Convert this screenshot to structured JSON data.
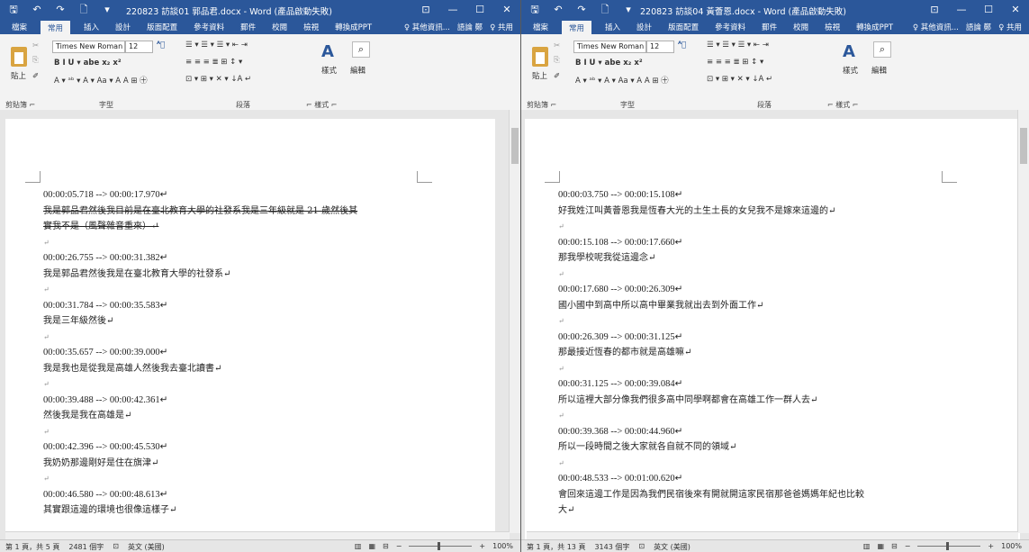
{
  "windows": [
    {
      "title": "220823 訪談01 郭品君.docx - Word (產品啟動失敗)",
      "qat": {
        "save": "🖫",
        "undo": "↶",
        "redo": "↷",
        "new": "🗋",
        "more": "▾"
      },
      "controls": {
        "ribbon_display": "⊡",
        "minimize": "—",
        "restore": "☐",
        "close": "✕"
      },
      "tabs": [
        "檔案",
        "常用",
        "插入",
        "設計",
        "版面配置",
        "參考資料",
        "郵件",
        "校閱",
        "檢視",
        "轉換成PPT"
      ],
      "tell_me": "♀ 其他資訊...",
      "user": "語論 鄭",
      "share": "♀ 共用",
      "ribbon": {
        "font_name": "Times New Roman",
        "font_size": "12",
        "paste": "貼上",
        "styles": "樣式",
        "edit": "編輯",
        "groups": [
          "剪貼簿 ⌐",
          "字型",
          "段落",
          "⌐ 樣式 ⌐"
        ],
        "format_row": "B  I  U ▾ abe x₂ x²",
        "color_row": "A ▾ ᵃᵇ ▾ A ▾ Aa ▾  A  A  ⊞  ㊉",
        "para_row1": "☰ ▾ ☰ ▾ ☰ ▾  ⇤ ⇥",
        "para_row2": "≡ ≡ ≡ ≣ ⊞  ↕ ▾",
        "para_row3": "⊡ ▾ ⊞ ▾  ✕ ▾  ↓A  ↵"
      },
      "lines": [
        {
          "t": "00:00:05.718 --> 00:00:17.970↵",
          "k": "ts"
        },
        {
          "t": "我是郭品君然後我目前是在臺北教育大學的社發系我是三年級就是 21 歲然後其",
          "k": "zh",
          "s": true
        },
        {
          "t": "實我不是（風聲雜音重來）↵",
          "k": "zh",
          "s": true
        },
        {
          "t": "↵",
          "k": "blank"
        },
        {
          "t": "00:00:26.755 --> 00:00:31.382↵",
          "k": "ts"
        },
        {
          "t": "我是郭品君然後我是在臺北教育大學的社發系↵",
          "k": "zh"
        },
        {
          "t": "↵",
          "k": "blank"
        },
        {
          "t": "00:00:31.784 --> 00:00:35.583↵",
          "k": "ts"
        },
        {
          "t": "我是三年級然後↵",
          "k": "zh"
        },
        {
          "t": "↵",
          "k": "blank"
        },
        {
          "t": "00:00:35.657 --> 00:00:39.000↵",
          "k": "ts"
        },
        {
          "t": "我是我也是從我是高雄人然後我去臺北讀書↵",
          "k": "zh"
        },
        {
          "t": "↵",
          "k": "blank"
        },
        {
          "t": "00:00:39.488 --> 00:00:42.361↵",
          "k": "ts"
        },
        {
          "t": "然後我是我在高雄是↵",
          "k": "zh"
        },
        {
          "t": "↵",
          "k": "blank"
        },
        {
          "t": "00:00:42.396 --> 00:00:45.530↵",
          "k": "ts"
        },
        {
          "t": "我奶奶那邊剛好是住在旗津↵",
          "k": "zh"
        },
        {
          "t": "↵",
          "k": "blank"
        },
        {
          "t": "00:00:46.580 --> 00:00:48.613↵",
          "k": "ts"
        },
        {
          "t": "其實跟這邊的環境也很像這樣子↵",
          "k": "zh"
        }
      ],
      "status": {
        "page": "第 1 頁，共 5 頁",
        "words": "2481 個字",
        "lang": "英文 (美國)",
        "zoom": "100%"
      }
    },
    {
      "title": "220823 訪談04 黃薈恩.docx - Word (產品啟動失敗)",
      "qat": {
        "save": "🖫",
        "undo": "↶",
        "redo": "↷",
        "new": "🗋",
        "more": "▾"
      },
      "controls": {
        "ribbon_display": "⊡",
        "minimize": "—",
        "restore": "☐",
        "close": "✕"
      },
      "tabs": [
        "檔案",
        "常用",
        "插入",
        "設計",
        "版面配置",
        "參考資料",
        "郵件",
        "校閱",
        "檢視",
        "轉換成PPT"
      ],
      "tell_me": "♀ 其他資訊...",
      "user": "語論 鄭",
      "share": "♀ 共用",
      "ribbon": {
        "font_name": "Times New Roman",
        "font_size": "12",
        "paste": "貼上",
        "styles": "樣式",
        "edit": "編輯",
        "groups": [
          "剪貼簿 ⌐",
          "字型",
          "段落",
          "⌐ 樣式 ⌐"
        ],
        "format_row": "B  I  U ▾ abe x₂ x²",
        "color_row": "A ▾ ᵃᵇ ▾ A ▾ Aa ▾  A  A  ⊞  ㊉",
        "para_row1": "☰ ▾ ☰ ▾ ☰ ▾  ⇤ ⇥",
        "para_row2": "≡ ≡ ≡ ≣ ⊞  ↕ ▾",
        "para_row3": "⊡ ▾ ⊞ ▾  ✕ ▾  ↓A  ↵"
      },
      "lines": [
        {
          "t": "00:00:03.750 --> 00:00:15.108↵",
          "k": "ts"
        },
        {
          "t": "好我姓江叫黃薈恩我是恆春大光的土生土長的女兒我不是嫁來這邊的↵",
          "k": "zh"
        },
        {
          "t": "↵",
          "k": "blank"
        },
        {
          "t": "00:00:15.108 --> 00:00:17.660↵",
          "k": "ts"
        },
        {
          "t": "那我學校呢我從這邊念↵",
          "k": "zh"
        },
        {
          "t": "↵",
          "k": "blank"
        },
        {
          "t": "00:00:17.680 --> 00:00:26.309↵",
          "k": "ts"
        },
        {
          "t": "國小國中到高中所以高中畢業我就出去到外面工作↵",
          "k": "zh"
        },
        {
          "t": "↵",
          "k": "blank"
        },
        {
          "t": "00:00:26.309 --> 00:00:31.125↵",
          "k": "ts"
        },
        {
          "t": "那最接近恆春的都市就是高雄嘛↵",
          "k": "zh"
        },
        {
          "t": "↵",
          "k": "blank"
        },
        {
          "t": "00:00:31.125 --> 00:00:39.084↵",
          "k": "ts"
        },
        {
          "t": "所以這裡大部分像我們很多高中同學啊都會在高雄工作一群人去↵",
          "k": "zh"
        },
        {
          "t": "↵",
          "k": "blank"
        },
        {
          "t": "00:00:39.368 --> 00:00:44.960↵",
          "k": "ts"
        },
        {
          "t": "所以一段時間之後大家就各自就不同的領域↵",
          "k": "zh"
        },
        {
          "t": "↵",
          "k": "blank"
        },
        {
          "t": "00:00:48.533 --> 00:01:00.620↵",
          "k": "ts"
        },
        {
          "t": "會回來這邊工作是因為我們民宿後來有開就開這家民宿那爸爸媽媽年紀也比較",
          "k": "zh"
        },
        {
          "t": "大↵",
          "k": "zh"
        }
      ],
      "status": {
        "page": "第 1 頁，共 13 頁",
        "words": "3143 個字",
        "lang": "英文 (美國)",
        "zoom": "100%"
      }
    }
  ]
}
